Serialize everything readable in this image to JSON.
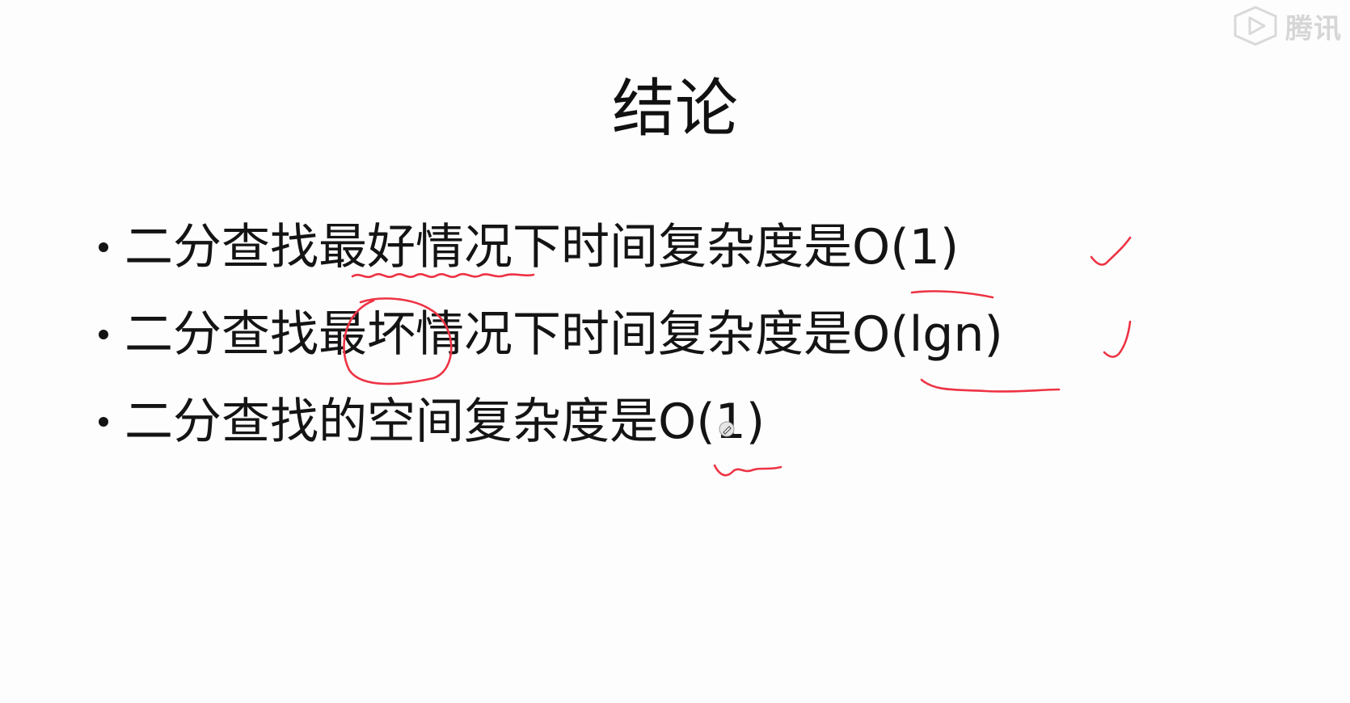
{
  "watermark": {
    "logo_icon": "play-hexagon-logo",
    "text": "腾讯"
  },
  "slide": {
    "title": "结论",
    "bullets": [
      {
        "text": "二分查找最好情况下时间复杂度是O(1)"
      },
      {
        "text": "二分查找最坏情况下时间复杂度是O(lgn)"
      },
      {
        "text": "二分查找的空间复杂度是O(1)"
      }
    ]
  },
  "annotations": {
    "color": "#ee3344",
    "marks": [
      "underline",
      "underline",
      "circle",
      "underline",
      "underline",
      "checkmark",
      "checkmark"
    ]
  },
  "cursor": {
    "icon": "pen-cursor-icon"
  }
}
